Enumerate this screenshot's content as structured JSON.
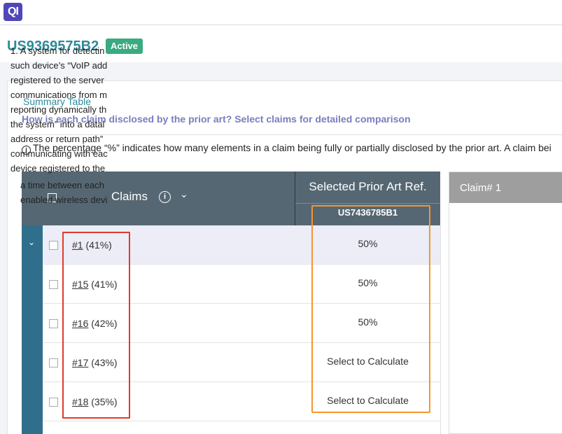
{
  "app": {
    "logo_text": "QI"
  },
  "patent": {
    "number": "US9369575B2",
    "status": "Active"
  },
  "summary": {
    "title": "Summary Table",
    "question": "How is each claim disclosed by the prior art? Select claims for detailed comparison",
    "note": "The percentage “%” indicates how many elements in a claim being fully or partially disclosed by the prior art. A claim bei"
  },
  "table": {
    "claims_header": "Claims",
    "prior_art_header": "Selected Prior Art Ref.",
    "prior_art_ref": "US7436785B1",
    "rows": [
      {
        "claim": "#1",
        "claim_pct": "(41%)",
        "prior_pct": "50%"
      },
      {
        "claim": "#15",
        "claim_pct": "(41%)",
        "prior_pct": "50%"
      },
      {
        "claim": "#16",
        "claim_pct": "(42%)",
        "prior_pct": "50%"
      },
      {
        "claim": "#17",
        "claim_pct": "(43%)",
        "prior_pct": "Select to Calculate"
      },
      {
        "claim": "#18",
        "claim_pct": "(35%)",
        "prior_pct": "Select to Calculate"
      }
    ]
  },
  "claim_panel": {
    "title": "Claim# 1",
    "lines": [
      "1. A system for detectin",
      "such device’s “VoIP add",
      "registered to the server",
      "communications from m",
      "reporting dynamically th",
      "the system” into a datal",
      "address or return path”",
      "communicating with eac",
      "device registered to the"
    ],
    "sub_lines": [
      "a time between each",
      "enabled wireless devi"
    ]
  },
  "colors": {
    "accent": "#2e8b9a",
    "status_badge": "#3aaa80",
    "header_bg": "#556772",
    "row_side": "#306f8c",
    "highlight_red": "#e23a2a",
    "highlight_orange": "#f5962d"
  }
}
